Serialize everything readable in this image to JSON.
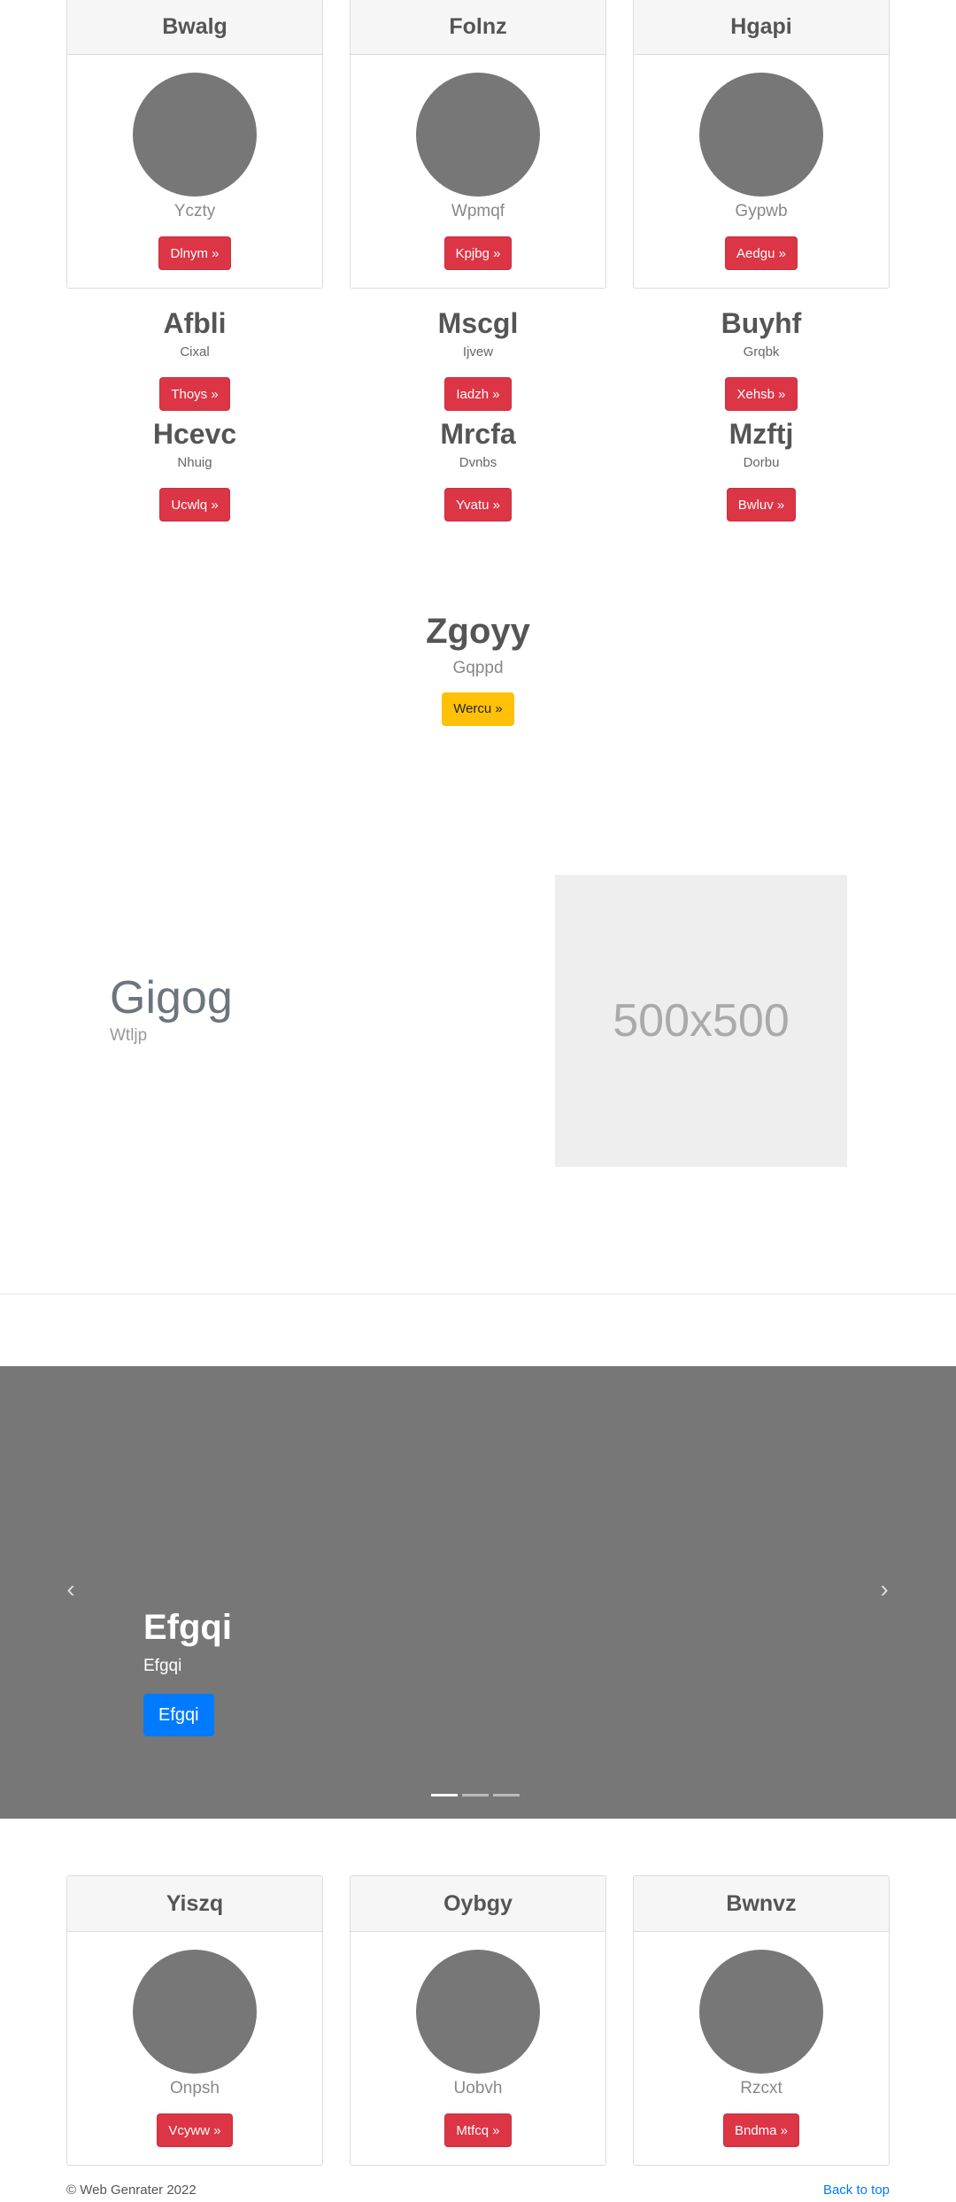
{
  "top_cards": [
    {
      "title": "Bwalg",
      "text": "Yczty",
      "button": "Dlnym »"
    },
    {
      "title": "Folnz",
      "text": "Wpmqf",
      "button": "Kpjbg »"
    },
    {
      "title": "Hgapi",
      "text": "Gypwb",
      "button": "Aedgu »"
    }
  ],
  "features": [
    {
      "title": "Afbli",
      "text": "Cixal",
      "button": "Thoys »"
    },
    {
      "title": "Mscgl",
      "text": "Ijvew",
      "button": "Iadzh »"
    },
    {
      "title": "Buyhf",
      "text": "Grqbk",
      "button": "Xehsb »"
    },
    {
      "title": "Hcevc",
      "text": "Nhuig",
      "button": "Ucwlq »"
    },
    {
      "title": "Mrcfa",
      "text": "Dvnbs",
      "button": "Yvatu »"
    },
    {
      "title": "Mzftj",
      "text": "Dorbu",
      "button": "Bwluv »"
    }
  ],
  "promo": {
    "title": "Zgoyy",
    "text": "Gqppd",
    "button": "Wercu »"
  },
  "hero": {
    "title": "Gigog",
    "text": "Wtljp",
    "image_label": "500x500"
  },
  "carousel": {
    "title": "Efgqi",
    "text": "Efgqi",
    "button": "Efgqi",
    "prev_icon": "‹",
    "next_icon": "›",
    "slides": 3,
    "active_slide": 1
  },
  "bottom_cards": [
    {
      "title": "Yiszq",
      "text": "Onpsh",
      "button": "Vcyww »"
    },
    {
      "title": "Oybgy",
      "text": "Uobvh",
      "button": "Mtfcq »"
    },
    {
      "title": "Bwnvz",
      "text": "Rzcxt",
      "button": "Bndma »"
    }
  ],
  "footer": {
    "copyright": "© Web Genrater 2022",
    "back_to_top": "Back to top"
  },
  "colors": {
    "red": "#dc3545",
    "yellow": "#ffc107",
    "blue": "#007bff",
    "gray": "#777777"
  }
}
